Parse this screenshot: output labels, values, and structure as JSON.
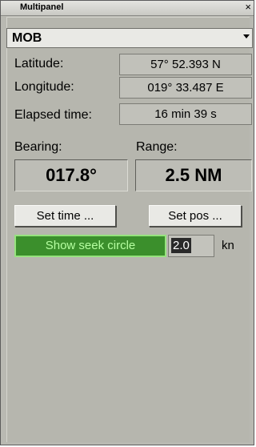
{
  "window": {
    "title": "Multipanel",
    "close_glyph": "×"
  },
  "mode_select": {
    "value": "MOB"
  },
  "position": {
    "latitude_label": "Latitude:",
    "latitude_value": "57° 52.393 N",
    "longitude_label": "Longitude:",
    "longitude_value": "019° 33.487 E",
    "elapsed_label": "Elapsed time:",
    "elapsed_value": "16 min 39 s"
  },
  "bearing": {
    "label": "Bearing:",
    "value": "017.8°"
  },
  "range": {
    "label": "Range:",
    "value": "2.5 NM"
  },
  "buttons": {
    "set_time": "Set time ...",
    "set_pos": "Set pos ..."
  },
  "seek": {
    "label": "Show seek circle",
    "speed_value": "2.0",
    "unit": "kn",
    "active_color": "#3b8f2c"
  },
  "icons": {
    "close": "close-icon",
    "dropdown": "chevron-down-icon"
  }
}
